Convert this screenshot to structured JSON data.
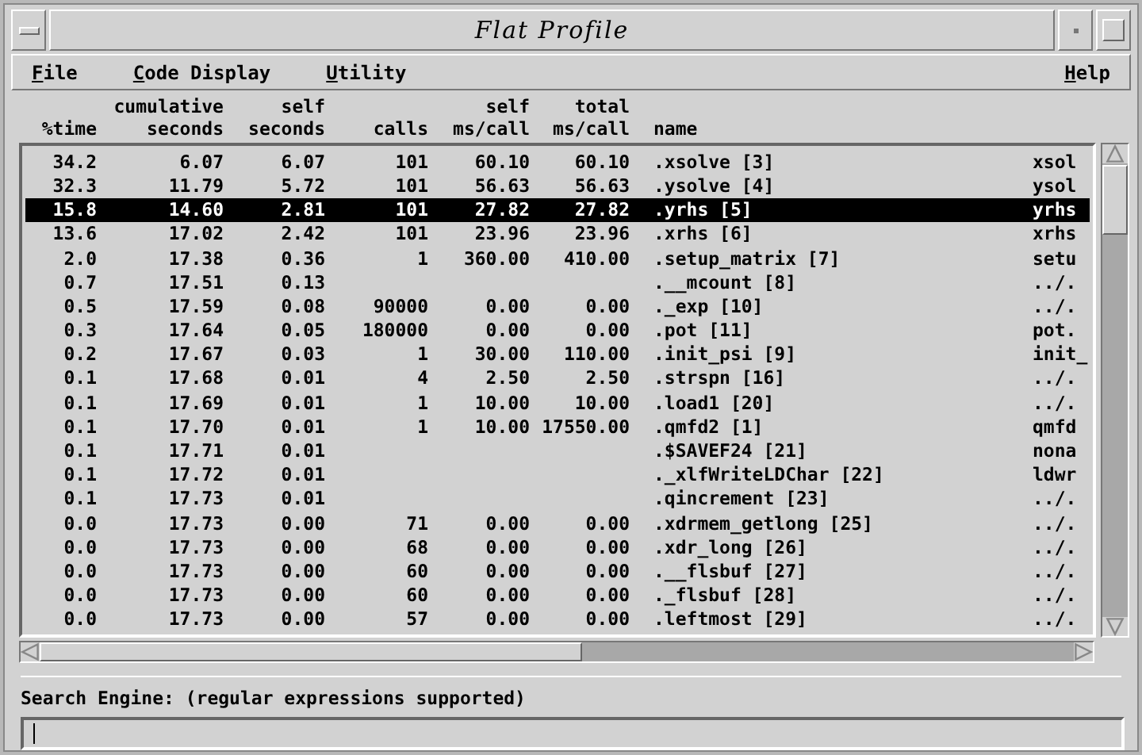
{
  "window": {
    "title": "Flat Profile"
  },
  "menu": [
    {
      "label": "File",
      "kind": "menu"
    },
    {
      "label": "Code Display",
      "kind": "menu"
    },
    {
      "label": "Utility",
      "kind": "menu"
    },
    {
      "label": "Help",
      "kind": "help"
    }
  ],
  "table": {
    "columns": [
      {
        "label": "%time"
      },
      {
        "top": "cumulative",
        "label": "seconds"
      },
      {
        "top": "self",
        "label": "seconds"
      },
      {
        "label": "calls"
      },
      {
        "top": "self",
        "label": "ms/call"
      },
      {
        "top": "total",
        "label": "ms/call"
      },
      {
        "label": "name"
      }
    ],
    "rows": [
      {
        "cells": [
          "34.2",
          "6.07",
          "6.07",
          "101",
          "60.10",
          "60.10",
          ".xsolve [3]",
          "xsol"
        ],
        "selected": false
      },
      {
        "cells": [
          "32.3",
          "11.79",
          "5.72",
          "101",
          "56.63",
          "56.63",
          ".ysolve [4]",
          "ysol"
        ],
        "selected": false
      },
      {
        "cells": [
          "15.8",
          "14.60",
          "2.81",
          "101",
          "27.82",
          "27.82",
          ".yrhs [5]",
          "yrhs"
        ],
        "selected": true
      },
      {
        "cells": [
          "13.6",
          "17.02",
          "2.42",
          "101",
          "23.96",
          "23.96",
          ".xrhs [6]",
          "xrhs"
        ],
        "selected": false
      },
      {
        "cells": [
          "2.0",
          "17.38",
          "0.36",
          "1",
          "360.00",
          "410.00",
          ".setup_matrix [7]",
          "setu"
        ],
        "selected": false
      },
      {
        "cells": [
          "0.7",
          "17.51",
          "0.13",
          null,
          null,
          null,
          ".__mcount [8]",
          "../."
        ],
        "selected": false
      },
      {
        "cells": [
          "0.5",
          "17.59",
          "0.08",
          "90000",
          "0.00",
          "0.00",
          "._exp [10]",
          "../."
        ],
        "selected": false
      },
      {
        "cells": [
          "0.3",
          "17.64",
          "0.05",
          "180000",
          "0.00",
          "0.00",
          ".pot [11]",
          "pot."
        ],
        "selected": false
      },
      {
        "cells": [
          "0.2",
          "17.67",
          "0.03",
          "1",
          "30.00",
          "110.00",
          ".init_psi [9]",
          "init_"
        ],
        "selected": false
      },
      {
        "cells": [
          "0.1",
          "17.68",
          "0.01",
          "4",
          "2.50",
          "2.50",
          ".strspn [16]",
          "../."
        ],
        "selected": false
      },
      {
        "cells": [
          "0.1",
          "17.69",
          "0.01",
          "1",
          "10.00",
          "10.00",
          ".load1 [20]",
          "../."
        ],
        "selected": false
      },
      {
        "cells": [
          "0.1",
          "17.70",
          "0.01",
          "1",
          "10.00",
          "17550.00",
          ".qmfd2 [1]",
          "qmfd"
        ],
        "selected": false
      },
      {
        "cells": [
          "0.1",
          "17.71",
          "0.01",
          null,
          null,
          null,
          ".$SAVEF24 [21]",
          "nona"
        ],
        "selected": false
      },
      {
        "cells": [
          "0.1",
          "17.72",
          "0.01",
          null,
          null,
          null,
          "._xlfWriteLDChar [22]",
          "ldwr"
        ],
        "selected": false
      },
      {
        "cells": [
          "0.1",
          "17.73",
          "0.01",
          null,
          null,
          null,
          ".qincrement [23]",
          "../."
        ],
        "selected": false
      },
      {
        "cells": [
          "0.0",
          "17.73",
          "0.00",
          "71",
          "0.00",
          "0.00",
          ".xdrmem_getlong [25]",
          "../."
        ],
        "selected": false
      },
      {
        "cells": [
          "0.0",
          "17.73",
          "0.00",
          "68",
          "0.00",
          "0.00",
          ".xdr_long [26]",
          "../."
        ],
        "selected": false
      },
      {
        "cells": [
          "0.0",
          "17.73",
          "0.00",
          "60",
          "0.00",
          "0.00",
          ".__flsbuf [27]",
          "../."
        ],
        "selected": false
      },
      {
        "cells": [
          "0.0",
          "17.73",
          "0.00",
          "60",
          "0.00",
          "0.00",
          "._flsbuf [28]",
          "../."
        ],
        "selected": false
      },
      {
        "cells": [
          "0.0",
          "17.73",
          "0.00",
          "57",
          "0.00",
          "0.00",
          ".leftmost [29]",
          "../."
        ],
        "selected": false
      }
    ]
  },
  "search": {
    "label": "Search Engine: (regular expressions supported)"
  }
}
